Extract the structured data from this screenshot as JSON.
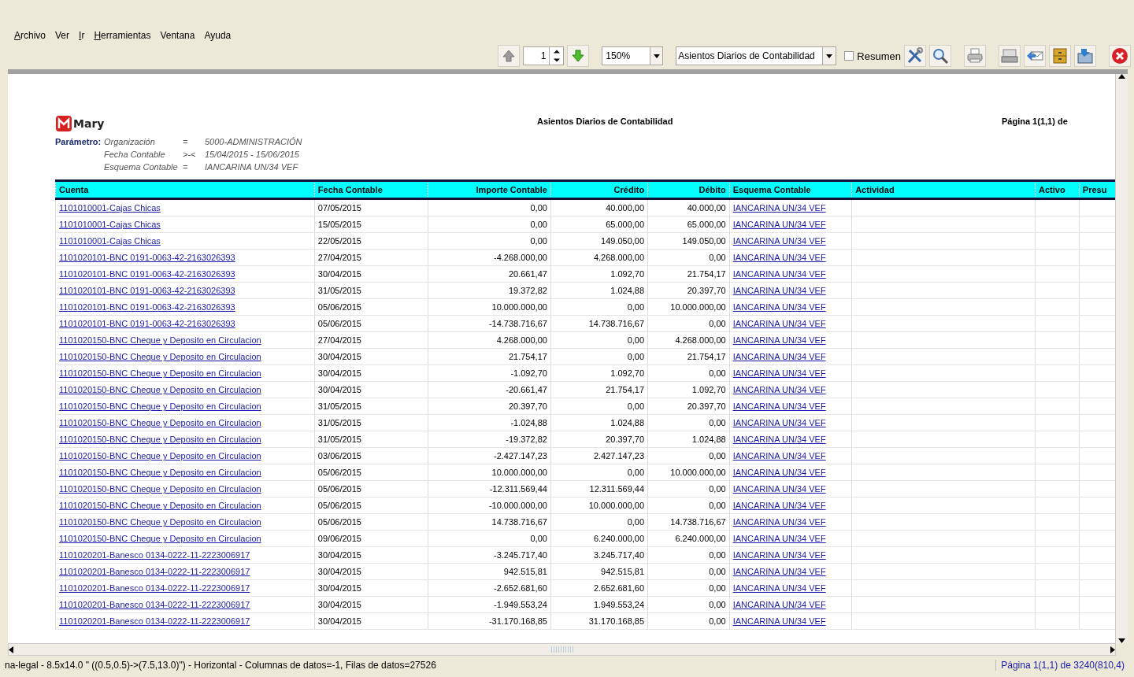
{
  "menu": [
    {
      "label": "Archivo",
      "underlined": true
    },
    {
      "label": "Ver",
      "underlined": false
    },
    {
      "label": "Ir",
      "underlined": true
    },
    {
      "label": "Herramientas",
      "underlined": true
    },
    {
      "label": "Ventana",
      "underlined": false
    },
    {
      "label": "Ayuda",
      "underlined": false
    }
  ],
  "toolbar": {
    "page": "1",
    "zoom": "150%",
    "report": "Asientos Diarios de Contabilidad",
    "summary": {
      "label": "Resumen",
      "checked": false
    }
  },
  "report": {
    "logo": "Mary",
    "title": "Asientos Diarios de Contabilidad",
    "page_label": "Página 1(1,1) de",
    "param_label": "Parámetro:",
    "parameters": [
      {
        "name": "Organización",
        "op": "=",
        "value": "5000-ADMINISTRACIÓN"
      },
      {
        "name": "Fecha Contable",
        "op": ">-<",
        "value": "15/04/2015 - 15/06/2015"
      },
      {
        "name": "Esquema Contable",
        "op": "=",
        "value": "IANCARINA UN/34 VEF"
      }
    ],
    "columns": [
      "Cuenta",
      "Fecha Contable",
      "Importe Contable",
      "Crédito",
      "Débito",
      "Esquema Contable",
      "Actividad",
      "Activo",
      "Presu"
    ],
    "rows": [
      [
        "1101010001-Cajas Chicas",
        "07/05/2015",
        "0,00",
        "40.000,00",
        "40.000,00",
        "IANCARINA UN/34 VEF"
      ],
      [
        "1101010001-Cajas Chicas",
        "15/05/2015",
        "0,00",
        "65.000,00",
        "65.000,00",
        "IANCARINA UN/34 VEF"
      ],
      [
        "1101010001-Cajas Chicas",
        "22/05/2015",
        "0,00",
        "149.050,00",
        "149.050,00",
        "IANCARINA UN/34 VEF"
      ],
      [
        "1101020101-BNC 0191-0063-42-2163026393",
        "27/04/2015",
        "-4.268.000,00",
        "4.268.000,00",
        "0,00",
        "IANCARINA UN/34 VEF"
      ],
      [
        "1101020101-BNC 0191-0063-42-2163026393",
        "30/04/2015",
        "20.661,47",
        "1.092,70",
        "21.754,17",
        "IANCARINA UN/34 VEF"
      ],
      [
        "1101020101-BNC 0191-0063-42-2163026393",
        "31/05/2015",
        "19.372,82",
        "1.024,88",
        "20.397,70",
        "IANCARINA UN/34 VEF"
      ],
      [
        "1101020101-BNC 0191-0063-42-2163026393",
        "05/06/2015",
        "10.000.000,00",
        "0,00",
        "10.000.000,00",
        "IANCARINA UN/34 VEF"
      ],
      [
        "1101020101-BNC 0191-0063-42-2163026393",
        "05/06/2015",
        "-14.738.716,67",
        "14.738.716,67",
        "0,00",
        "IANCARINA UN/34 VEF"
      ],
      [
        "1101020150-BNC Cheque y Deposito en Circulacion",
        "27/04/2015",
        "4.268.000,00",
        "0,00",
        "4.268.000,00",
        "IANCARINA UN/34 VEF"
      ],
      [
        "1101020150-BNC Cheque y Deposito en Circulacion",
        "30/04/2015",
        "21.754,17",
        "0,00",
        "21.754,17",
        "IANCARINA UN/34 VEF"
      ],
      [
        "1101020150-BNC Cheque y Deposito en Circulacion",
        "30/04/2015",
        "-1.092,70",
        "1.092,70",
        "0,00",
        "IANCARINA UN/34 VEF"
      ],
      [
        "1101020150-BNC Cheque y Deposito en Circulacion",
        "30/04/2015",
        "-20.661,47",
        "21.754,17",
        "1.092,70",
        "IANCARINA UN/34 VEF"
      ],
      [
        "1101020150-BNC Cheque y Deposito en Circulacion",
        "31/05/2015",
        "20.397,70",
        "0,00",
        "20.397,70",
        "IANCARINA UN/34 VEF"
      ],
      [
        "1101020150-BNC Cheque y Deposito en Circulacion",
        "31/05/2015",
        "-1.024,88",
        "1.024,88",
        "0,00",
        "IANCARINA UN/34 VEF"
      ],
      [
        "1101020150-BNC Cheque y Deposito en Circulacion",
        "31/05/2015",
        "-19.372,82",
        "20.397,70",
        "1.024,88",
        "IANCARINA UN/34 VEF"
      ],
      [
        "1101020150-BNC Cheque y Deposito en Circulacion",
        "03/06/2015",
        "-2.427.147,23",
        "2.427.147,23",
        "0,00",
        "IANCARINA UN/34 VEF"
      ],
      [
        "1101020150-BNC Cheque y Deposito en Circulacion",
        "05/06/2015",
        "10.000.000,00",
        "0,00",
        "10.000.000,00",
        "IANCARINA UN/34 VEF"
      ],
      [
        "1101020150-BNC Cheque y Deposito en Circulacion",
        "05/06/2015",
        "-12.311.569,44",
        "12.311.569,44",
        "0,00",
        "IANCARINA UN/34 VEF"
      ],
      [
        "1101020150-BNC Cheque y Deposito en Circulacion",
        "05/06/2015",
        "-10.000.000,00",
        "10.000.000,00",
        "0,00",
        "IANCARINA UN/34 VEF"
      ],
      [
        "1101020150-BNC Cheque y Deposito en Circulacion",
        "05/06/2015",
        "14.738.716,67",
        "0,00",
        "14.738.716,67",
        "IANCARINA UN/34 VEF"
      ],
      [
        "1101020150-BNC Cheque y Deposito en Circulacion",
        "09/06/2015",
        "0,00",
        "6.240.000,00",
        "6.240.000,00",
        "IANCARINA UN/34 VEF"
      ],
      [
        "1101020201-Banesco 0134-0222-11-2223006917",
        "30/04/2015",
        "-3.245.717,40",
        "3.245.717,40",
        "0,00",
        "IANCARINA UN/34 VEF"
      ],
      [
        "1101020201-Banesco 0134-0222-11-2223006917",
        "30/04/2015",
        "942.515,81",
        "942.515,81",
        "0,00",
        "IANCARINA UN/34 VEF"
      ],
      [
        "1101020201-Banesco 0134-0222-11-2223006917",
        "30/04/2015",
        "-2.652.681,60",
        "2.652.681,60",
        "0,00",
        "IANCARINA UN/34 VEF"
      ],
      [
        "1101020201-Banesco 0134-0222-11-2223006917",
        "30/04/2015",
        "-1.949.553,24",
        "1.949.553,24",
        "0,00",
        "IANCARINA UN/34 VEF"
      ],
      [
        "1101020201-Banesco 0134-0222-11-2223006917",
        "30/04/2015",
        "-31.170.168,85",
        "31.170.168,85",
        "0,00",
        "IANCARINA UN/34 VEF"
      ]
    ]
  },
  "status": {
    "info": "na-legal - 8.5x14.0 \" ((0.5,0.5)->(7.5,13.0)\") - Horizontal - Columnas de datos=-1, Filas de datos=27526",
    "page": "Página 1(1,1) de 3240(810,4)"
  }
}
